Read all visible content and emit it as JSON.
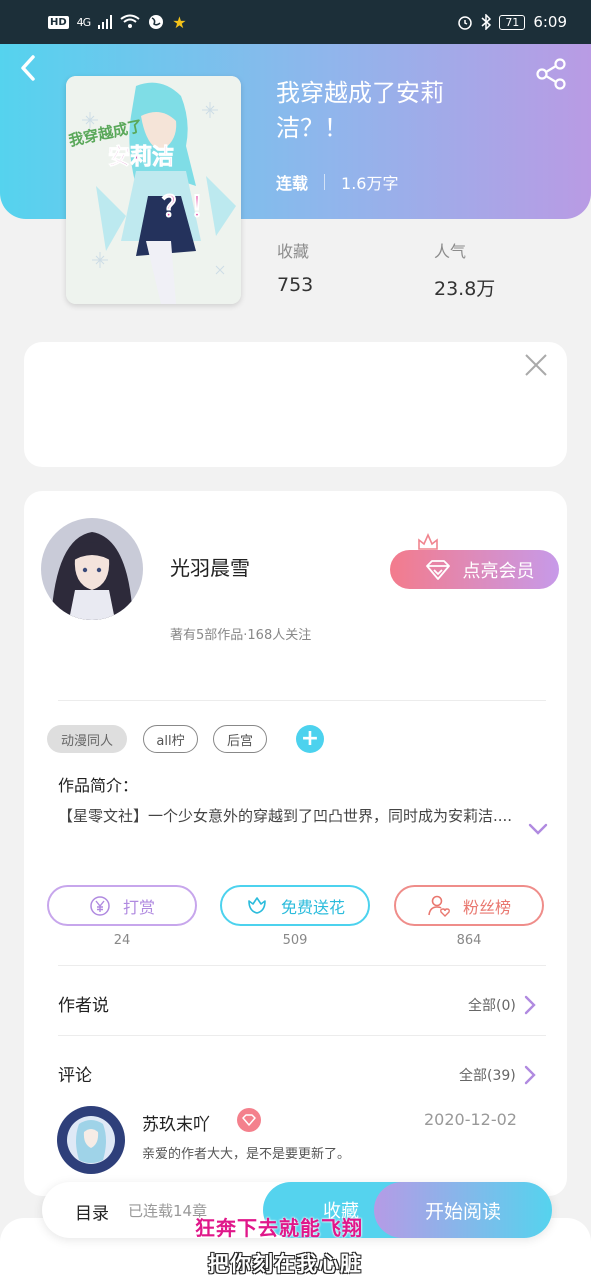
{
  "status_bar": {
    "hd": "HD",
    "network": "4G",
    "time": "6:09",
    "battery": "71"
  },
  "book": {
    "title": "我穿越成了安莉洁？！",
    "status": "连载",
    "word_count": "1.6万字",
    "cover_text_top": "我穿越成了",
    "cover_text_main": "安莉洁",
    "cover_text_bottom": "？！",
    "stats": {
      "favorites_label": "收藏",
      "favorites_value": "753",
      "popularity_label": "人气",
      "popularity_value": "23.8万"
    }
  },
  "author": {
    "name": "光羽晨雪",
    "info": "著有5部作品·168人关注",
    "vip_button": "点亮会员"
  },
  "tags": [
    "动漫同人",
    "all柠",
    "后宫"
  ],
  "intro": {
    "label": "作品简介：",
    "text": "【星零文社】一个少女意外的穿越到了凹凸世界，同时成为安莉洁...."
  },
  "actions": [
    {
      "label": "打赏",
      "count": "24"
    },
    {
      "label": "免费送花",
      "count": "509"
    },
    {
      "label": "粉丝榜",
      "count": "864"
    }
  ],
  "author_says": {
    "title": "作者说",
    "more": "全部(0)"
  },
  "comments": {
    "title": "评论",
    "more": "全部(39)",
    "items": [
      {
        "user": "苏玖末吖",
        "date": "2020-12-02",
        "text": "亲爱的作者大大，是不是要更新了。"
      }
    ]
  },
  "bottom_bar": {
    "toc": "目录",
    "serial": "已连载14章",
    "favorite": "收藏",
    "read": "开始阅读"
  },
  "lyrics": {
    "line1": "狂奔下去就能飞翔",
    "line2": "把你刻在我心脏"
  },
  "colors": {
    "hero_start": "#55d3ee",
    "hero_end": "#b99be4",
    "reward": "#b08ae0",
    "flower": "#4cd2ee",
    "fans": "#ef8d8a",
    "lyric_pink": "#e0178a"
  },
  "icons": [
    "back-icon",
    "share-icon",
    "close-icon",
    "crown-icon",
    "diamond-icon",
    "plus-icon",
    "chevron-down-icon",
    "yen-icon",
    "flower-icon",
    "fan-icon",
    "chevron-right-icon"
  ]
}
